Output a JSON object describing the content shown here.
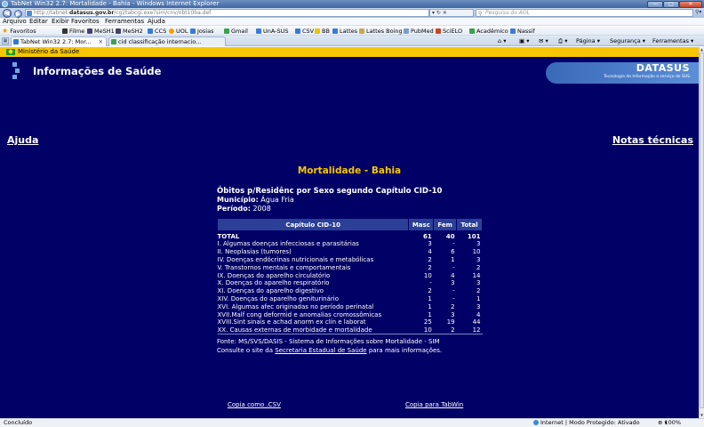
{
  "window": {
    "title": "TabNet Win32 2.7: Mortalidade - Bahia - Windows Internet Explorer"
  },
  "address": {
    "url_prefix": "http://tabnet.",
    "url_domain": "datasus.gov.br",
    "url_suffix": "/cgi/tabcgi.exe?sim/cnv/obt10ba.def",
    "search_placeholder": "Pesquisa do AOL"
  },
  "menu": [
    "Arquivo",
    "Editar",
    "Exibir",
    "Favoritos",
    "Ferramentas",
    "Ajuda"
  ],
  "favorites": {
    "label": "Favoritos",
    "items": [
      "Filme",
      "MeSH1",
      "MeSH2",
      "CCS",
      "UOL",
      "Josias",
      "Gmail",
      "UnA-SUS",
      "CSV",
      "BB",
      "Lattes",
      "Lattes Boing",
      "PubMed",
      "SciELO",
      "Acadêmico",
      "Nassif"
    ]
  },
  "tabs": [
    {
      "label": "TabNet Win32 2.7: Mor..."
    },
    {
      "label": "cid classificação internacio..."
    }
  ],
  "command_bar": [
    "Página",
    "Segurança",
    "Ferramentas"
  ],
  "page": {
    "gov_label": "Ministério da Saúde",
    "brand": "Informações de Saúde",
    "datasus_title": "DATASUS",
    "datasus_subtitle": "Tecnologia da Informação a serviço do SUS",
    "link_help": "Ajuda",
    "link_notes": "Notas técnicas",
    "report_title": "Mortalidade - Bahia",
    "heading": "Óbitos p/Residênc por Sexo segundo Capítulo CID-10",
    "municipio_label": "Município:",
    "municipio_value": "Água Fria",
    "periodo_label": "Período:",
    "periodo_value": "2008"
  },
  "table": {
    "headers": [
      "Capítulo CID-10",
      "Masc",
      "Fem",
      "Total"
    ],
    "rows": [
      [
        "TOTAL",
        "61",
        "40",
        "101"
      ],
      [
        "I. Algumas doenças infecciosas e parasitárias",
        "3",
        "-",
        "3"
      ],
      [
        "II. Neoplasias (tumores)",
        "4",
        "6",
        "10"
      ],
      [
        "IV. Doenças endócrinas nutricionais e metabólicas",
        "2",
        "1",
        "3"
      ],
      [
        "V. Transtornos mentais e comportamentais",
        "2",
        "-",
        "2"
      ],
      [
        "IX. Doenças do aparelho circulatório",
        "10",
        "4",
        "14"
      ],
      [
        "X. Doenças do aparelho respiratório",
        "-",
        "3",
        "3"
      ],
      [
        "XI. Doenças do aparelho digestivo",
        "2",
        "-",
        "2"
      ],
      [
        "XIV. Doenças do aparelho geniturinário",
        "1",
        "-",
        "1"
      ],
      [
        "XVI. Algumas afec originadas no período perinatal",
        "1",
        "2",
        "3"
      ],
      [
        "XVII.Malf cong deformid e anomalias cromossômicas",
        "1",
        "3",
        "4"
      ],
      [
        "XVIII.Sint sinais e achad anorm ex clín e laborat",
        "25",
        "19",
        "44"
      ],
      [
        "XX. Causas externas de morbidade e mortalidade",
        "10",
        "2",
        "12"
      ]
    ]
  },
  "footnote": {
    "line1": "Fonte: MS/SVS/DASIS - Sistema de Informações sobre Mortalidade - SIM",
    "line2_pre": "Consulte o site da ",
    "line2_link": "Secretaria Estadual de Saúde",
    "line2_post": " para mais informações."
  },
  "actions": {
    "copy_csv": "Copia como .CSV",
    "copy_tabwin": "Copia para TabWin"
  },
  "status": {
    "left": "Concluído",
    "zone": "Internet | Modo Protegido: Ativado",
    "zoom": "100%"
  },
  "colors": {
    "page_bg": "#000066",
    "title_yellow": "#f7c600",
    "header_blue": "#2b3f97"
  }
}
